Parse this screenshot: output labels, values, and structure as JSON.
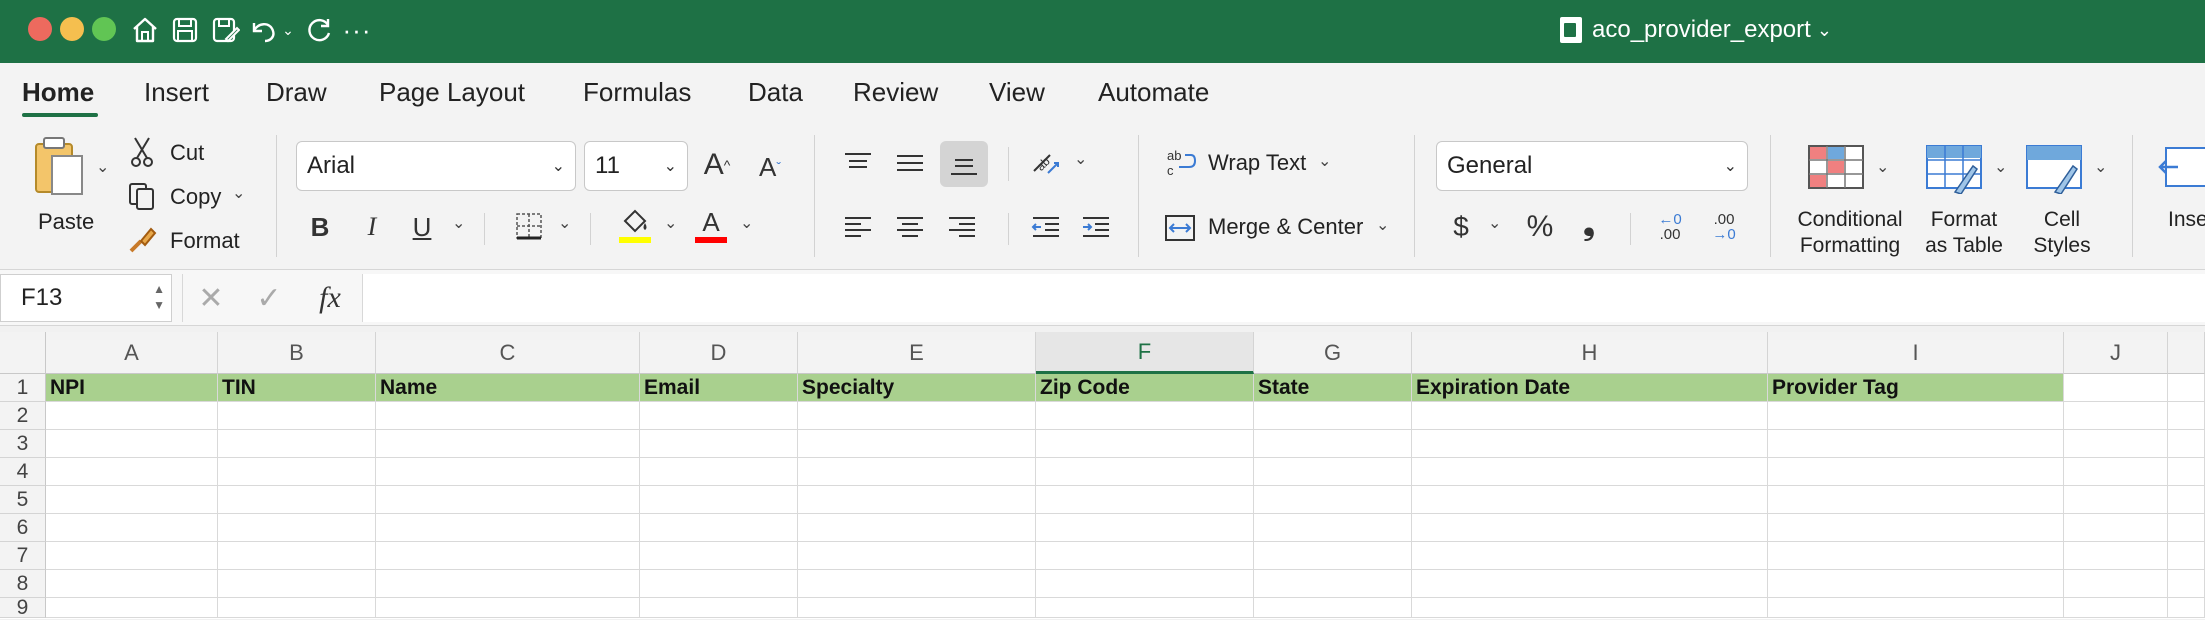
{
  "titlebar": {
    "document_title": "aco_provider_export",
    "colors": {
      "background": "#1e7145",
      "close": "#ed6a5e",
      "minimize": "#f5bf4f",
      "zoom": "#61c554"
    },
    "icons": [
      "home-icon",
      "save-icon",
      "save-as-icon",
      "undo-icon",
      "redo-icon",
      "more-icon"
    ]
  },
  "tabs": [
    {
      "label": "Home",
      "active": true
    },
    {
      "label": "Insert"
    },
    {
      "label": "Draw"
    },
    {
      "label": "Page Layout"
    },
    {
      "label": "Formulas"
    },
    {
      "label": "Data"
    },
    {
      "label": "Review"
    },
    {
      "label": "View"
    },
    {
      "label": "Automate"
    }
  ],
  "ribbon": {
    "clipboard": {
      "paste": "Paste",
      "cut": "Cut",
      "copy": "Copy",
      "format": "Format"
    },
    "font": {
      "name": "Arial",
      "size": "11",
      "bold": "B",
      "italic": "I",
      "underline": "U",
      "fill_color": "#ffff00",
      "font_color": "#ff0000"
    },
    "alignment": {
      "wrap_text": "Wrap Text",
      "merge_center": "Merge & Center"
    },
    "number": {
      "format": "General",
      "currency": "$",
      "percent": "%",
      "comma": "❟",
      "increase_decimal": ".00",
      "decrease_decimal": ".00"
    },
    "styles": {
      "conditional_formatting": [
        "Conditional",
        "Formatting"
      ],
      "format_as_table": [
        "Format",
        "as Table"
      ],
      "cell_styles": [
        "Cell",
        "Styles"
      ],
      "insert": "Inse"
    }
  },
  "formula_bar": {
    "name_box": "F13",
    "fx": "fx",
    "value": ""
  },
  "sheet": {
    "columns": [
      "A",
      "B",
      "C",
      "D",
      "E",
      "F",
      "G",
      "H",
      "I",
      "J"
    ],
    "selected_column": "F",
    "rows": [
      "1",
      "2",
      "3",
      "4",
      "5",
      "6",
      "7",
      "8",
      "9"
    ],
    "header_row": [
      "NPI",
      "TIN",
      "Name",
      "Email",
      "Specialty",
      "Zip Code",
      "State",
      "Expiration Date",
      "Provider Tag",
      ""
    ],
    "header_fill": "#a9d08e"
  }
}
